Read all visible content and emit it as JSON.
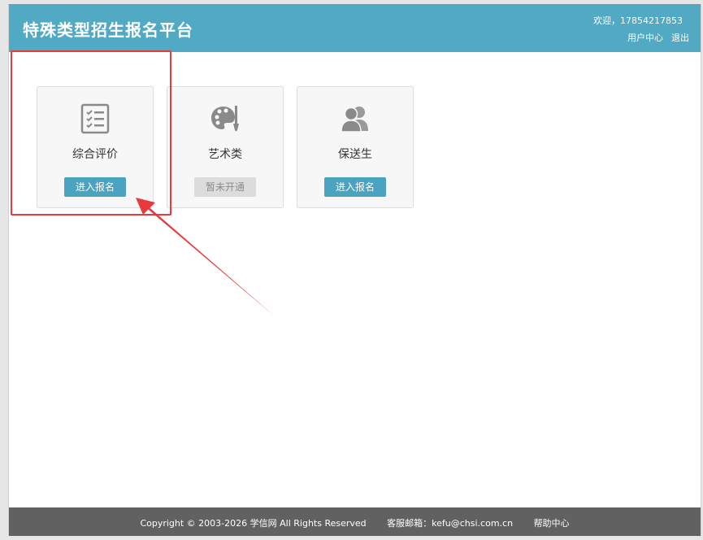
{
  "header": {
    "title": "特殊类型招生报名平台",
    "welcome": "欢迎，17854217853",
    "user_center": "用户中心",
    "logout": "退出",
    "bg_color": "#51a9c4"
  },
  "cards": [
    {
      "label": "综合评价",
      "button": "进入报名",
      "icon": "checklist-icon",
      "enabled": true
    },
    {
      "label": "艺术类",
      "button": "暂未开通",
      "icon": "palette-icon",
      "enabled": false
    },
    {
      "label": "保送生",
      "button": "进入报名",
      "icon": "users-icon",
      "enabled": true
    }
  ],
  "footer": {
    "copyright": "Copyright © 2003-2026 学信网 All Rights Reserved",
    "email": "客服邮箱：kefu@chsi.com.cn",
    "help": "帮助中心",
    "bg_color": "#616161"
  },
  "annotation": {
    "color": "#e83a3a"
  }
}
